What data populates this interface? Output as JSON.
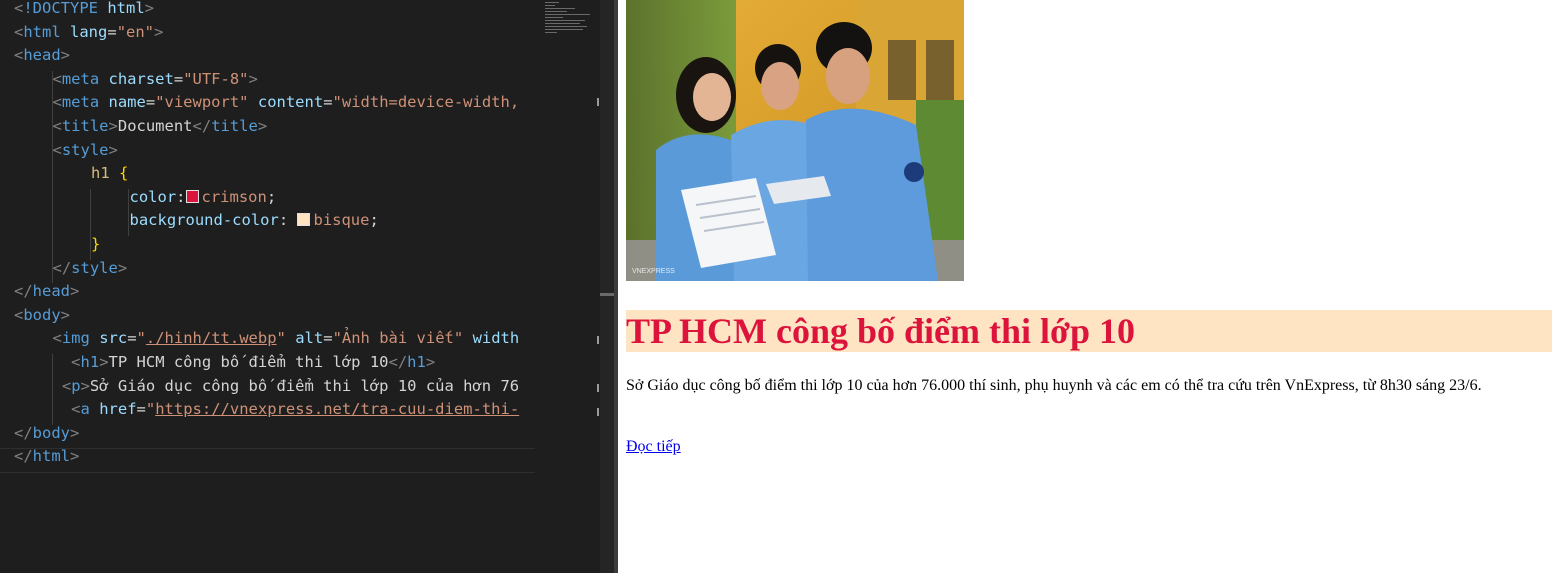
{
  "editor": {
    "lines": [
      {
        "indent": 0,
        "tokens": [
          {
            "c": "t-br",
            "t": "<"
          },
          {
            "c": "t-tag",
            "t": "!DOCTYPE"
          },
          {
            "c": "t-tx",
            "t": " "
          },
          {
            "c": "t-at",
            "t": "html"
          },
          {
            "c": "t-br",
            "t": ">"
          }
        ]
      },
      {
        "indent": 0,
        "tokens": [
          {
            "c": "t-br",
            "t": "<"
          },
          {
            "c": "t-tag",
            "t": "html"
          },
          {
            "c": "t-tx",
            "t": " "
          },
          {
            "c": "t-at",
            "t": "lang"
          },
          {
            "c": "t-tx",
            "t": "="
          },
          {
            "c": "t-st",
            "t": "\"en\""
          },
          {
            "c": "t-br",
            "t": ">"
          }
        ]
      },
      {
        "indent": 0,
        "tokens": [
          {
            "c": "t-br",
            "t": "<"
          },
          {
            "c": "t-tag",
            "t": "head"
          },
          {
            "c": "t-br",
            "t": ">"
          }
        ]
      },
      {
        "indent": 1,
        "tokens": [
          {
            "c": "t-br",
            "t": "<"
          },
          {
            "c": "t-tag",
            "t": "meta"
          },
          {
            "c": "t-tx",
            "t": " "
          },
          {
            "c": "t-at",
            "t": "charset"
          },
          {
            "c": "t-tx",
            "t": "="
          },
          {
            "c": "t-st",
            "t": "\"UTF-8\""
          },
          {
            "c": "t-br",
            "t": ">"
          }
        ]
      },
      {
        "indent": 1,
        "tokens": [
          {
            "c": "t-br",
            "t": "<"
          },
          {
            "c": "t-tag",
            "t": "meta"
          },
          {
            "c": "t-tx",
            "t": " "
          },
          {
            "c": "t-at",
            "t": "name"
          },
          {
            "c": "t-tx",
            "t": "="
          },
          {
            "c": "t-st",
            "t": "\"viewport\""
          },
          {
            "c": "t-tx",
            "t": " "
          },
          {
            "c": "t-at",
            "t": "content"
          },
          {
            "c": "t-tx",
            "t": "="
          },
          {
            "c": "t-st",
            "t": "\"width=device-width,"
          }
        ]
      },
      {
        "indent": 1,
        "tokens": [
          {
            "c": "t-br",
            "t": "<"
          },
          {
            "c": "t-tag",
            "t": "title"
          },
          {
            "c": "t-br",
            "t": ">"
          },
          {
            "c": "t-tx",
            "t": "Document"
          },
          {
            "c": "t-br",
            "t": "</"
          },
          {
            "c": "t-tag",
            "t": "title"
          },
          {
            "c": "t-br",
            "t": ">"
          }
        ]
      },
      {
        "indent": 1,
        "tokens": [
          {
            "c": "t-br",
            "t": "<"
          },
          {
            "c": "t-tag",
            "t": "style"
          },
          {
            "c": "t-br",
            "t": ">"
          }
        ]
      },
      {
        "indent": 2,
        "tokens": [
          {
            "c": "t-sel",
            "t": "h1"
          },
          {
            "c": "t-tx",
            "t": " "
          },
          {
            "c": "t-cu",
            "t": "{"
          }
        ]
      },
      {
        "indent": 3,
        "tokens": [
          {
            "c": "t-pr",
            "t": "color"
          },
          {
            "c": "t-tx",
            "t": ":"
          },
          {
            "c": "swatch",
            "t": "#dc143c"
          },
          {
            "c": "t-va",
            "t": "crimson"
          },
          {
            "c": "t-tx",
            "t": ";"
          }
        ]
      },
      {
        "indent": 3,
        "tokens": [
          {
            "c": "t-pr",
            "t": "background-color"
          },
          {
            "c": "t-tx",
            "t": ": "
          },
          {
            "c": "swatch",
            "t": "#ffe4c4"
          },
          {
            "c": "t-va",
            "t": "bisque"
          },
          {
            "c": "t-tx",
            "t": ";"
          }
        ]
      },
      {
        "indent": 2,
        "tokens": [
          {
            "c": "t-cu",
            "t": "}"
          }
        ]
      },
      {
        "indent": 1,
        "tokens": [
          {
            "c": "t-br",
            "t": "</"
          },
          {
            "c": "t-tag",
            "t": "style"
          },
          {
            "c": "t-br",
            "t": ">"
          }
        ]
      },
      {
        "indent": 0,
        "tokens": [
          {
            "c": "t-br",
            "t": "</"
          },
          {
            "c": "t-tag",
            "t": "head"
          },
          {
            "c": "t-br",
            "t": ">"
          }
        ]
      },
      {
        "indent": 0,
        "tokens": [
          {
            "c": "t-br",
            "t": "<"
          },
          {
            "c": "t-tag",
            "t": "body"
          },
          {
            "c": "t-br",
            "t": ">"
          }
        ]
      },
      {
        "indent": 1,
        "tokens": [
          {
            "c": "t-br",
            "t": "<"
          },
          {
            "c": "t-tag",
            "t": "img"
          },
          {
            "c": "t-tx",
            "t": " "
          },
          {
            "c": "t-at",
            "t": "src"
          },
          {
            "c": "t-tx",
            "t": "="
          },
          {
            "c": "t-st",
            "t": "\""
          },
          {
            "c": "t-link",
            "t": "./hinh/tt.webp"
          },
          {
            "c": "t-st",
            "t": "\""
          },
          {
            "c": "t-tx",
            "t": " "
          },
          {
            "c": "t-at",
            "t": "alt"
          },
          {
            "c": "t-tx",
            "t": "="
          },
          {
            "c": "t-st",
            "t": "\"Ảnh bài viết\""
          },
          {
            "c": "t-tx",
            "t": " "
          },
          {
            "c": "t-at",
            "t": "width"
          }
        ]
      },
      {
        "indent": 1,
        "pre": "  ",
        "tokens": [
          {
            "c": "t-br",
            "t": "<"
          },
          {
            "c": "t-tag",
            "t": "h1"
          },
          {
            "c": "t-br",
            "t": ">"
          },
          {
            "c": "t-tx",
            "t": "TP HCM công bố điểm thi lớp 10"
          },
          {
            "c": "t-br",
            "t": "</"
          },
          {
            "c": "t-tag",
            "t": "h1"
          },
          {
            "c": "t-br",
            "t": ">"
          }
        ]
      },
      {
        "indent": 1,
        "pre": " ",
        "tokens": [
          {
            "c": "t-br",
            "t": "<"
          },
          {
            "c": "t-tag",
            "t": "p"
          },
          {
            "c": "t-br",
            "t": ">"
          },
          {
            "c": "t-tx",
            "t": "Sở Giáo dục công bố điểm thi lớp 10 của hơn 76"
          }
        ]
      },
      {
        "indent": 1,
        "pre": "  ",
        "tokens": [
          {
            "c": "t-br",
            "t": "<"
          },
          {
            "c": "t-tag",
            "t": "a"
          },
          {
            "c": "t-tx",
            "t": " "
          },
          {
            "c": "t-at",
            "t": "href"
          },
          {
            "c": "t-tx",
            "t": "="
          },
          {
            "c": "t-st",
            "t": "\""
          },
          {
            "c": "t-link",
            "t": "https://vnexpress.net/tra-cuu-diem-thi-"
          }
        ]
      },
      {
        "indent": 0,
        "tokens": [
          {
            "c": "t-br",
            "t": "</"
          },
          {
            "c": "t-tag",
            "t": "body"
          },
          {
            "c": "t-br",
            "t": ">"
          }
        ]
      },
      {
        "indent": 0,
        "tokens": [
          {
            "c": "t-br",
            "t": "</"
          },
          {
            "c": "t-tag",
            "t": "html"
          },
          {
            "c": "t-br",
            "t": ">"
          }
        ]
      }
    ]
  },
  "preview": {
    "image_alt": "Ảnh bài viết",
    "image_watermark": "VNEXPRESS",
    "heading": "TP HCM công bố điểm thi lớp 10",
    "heading_color": "#dc143c",
    "heading_bg": "#ffe4c4",
    "paragraph": "Sở Giáo dục công bố điểm thi lớp 10 của hơn 76.000 thí sinh, phụ huynh và các em có thể tra cứu trên VnExpress, từ 8h30 sáng 23/6.",
    "link_text": "Đọc tiếp"
  }
}
